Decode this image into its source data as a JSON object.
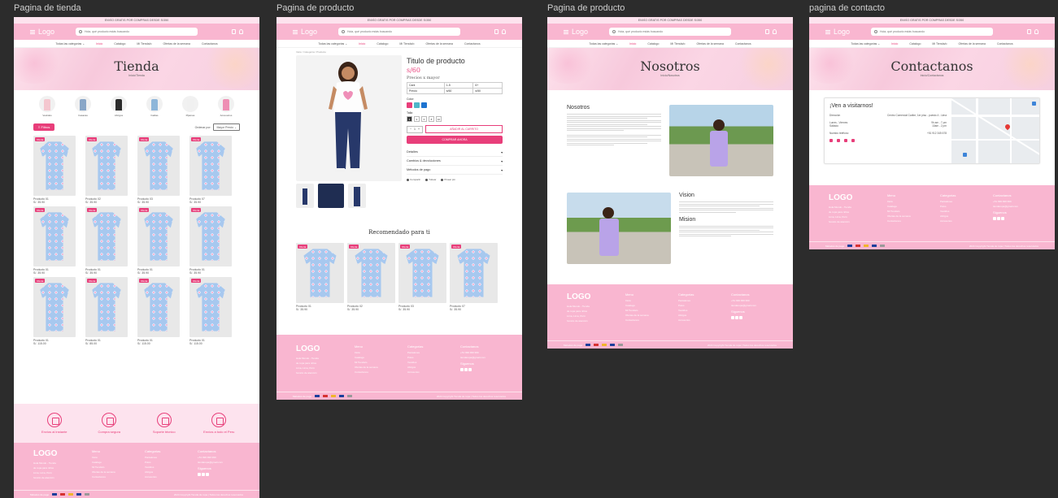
{
  "frame_labels": [
    "Pagina de tienda",
    "Pagina de producto",
    "Pagina de producto",
    "pagina de contacto"
  ],
  "common": {
    "promo": "ENVÍO GRATIS POR COMPRAS DESDE S/350",
    "logo": "Logo",
    "search_placeholder": "Hola, qué producto estás buscando",
    "nav": [
      "Todas las categorias",
      "Inicio",
      "Catalogo",
      "Mi Tienda/o",
      "Ofertas de la semana",
      "Contactanos"
    ],
    "footer": {
      "logo": "LOGO",
      "about": [
        "Hola Mundo - Tienda",
        "de ropa para niños",
        "Lima, Lima, Perú",
        "horario de atención"
      ],
      "col1_title": "Menu",
      "col1": [
        "Inicio",
        "Catalogo",
        "Mi Tienda/o",
        "Ofertas de la semana",
        "Contactanos"
      ],
      "col2_title": "Categorias",
      "col2": [
        "Pantalones",
        "Polos",
        "Vestidos",
        "Abrigos",
        "Accesorios"
      ],
      "col3_title": "Contactanos",
      "col3": [
        "+51 999 999 999",
        "tiendaropa@gmail.com"
      ],
      "follow": "Siguenos",
      "payment_label": "Métodos de pago",
      "copyright": "2024 Copyright Tienda de ropa | Todos los derechos reservados"
    }
  },
  "tienda": {
    "title": "Tienda",
    "breadcrumb": "Inicio/Tienda",
    "categories": [
      "Vestidos",
      "Casacas",
      "Abrigos",
      "Faldas",
      "Pijamas",
      "Accesorios"
    ],
    "filters_label": "Filtros",
    "sort_label": "Ordenar por:",
    "sort_value": "Mayor Precio",
    "badge": "Oferta",
    "products": [
      {
        "name": "Producto 01",
        "price": "S/. 35.90"
      },
      {
        "name": "Producto 02",
        "price": "S/. 35.90"
      },
      {
        "name": "Producto 03",
        "price": "S/. 35.90"
      },
      {
        "name": "Producto 07",
        "price": "S/. 35.90"
      },
      {
        "name": "Producto 01",
        "price": "S/. 35.90"
      },
      {
        "name": "Producto 01",
        "price": "S/. 35.90"
      },
      {
        "name": "Producto 01",
        "price": "S/. 35.90"
      },
      {
        "name": "Producto 01",
        "price": "S/. 35.90"
      },
      {
        "name": "Producto 01",
        "price": "S/. 115.00"
      },
      {
        "name": "Producto 01",
        "price": "S/. 85.00"
      },
      {
        "name": "Producto 01",
        "price": "S/. 115.00"
      },
      {
        "name": "Producto 01",
        "price": "S/. 115.00"
      }
    ],
    "services": [
      "Envíos al instante",
      "Compra segura",
      "Soporte técnico",
      "Envíos a todo el Peru"
    ]
  },
  "producto": {
    "breadcrumb": "Inicio / Categoria / Producto",
    "title": "Titulo de producto",
    "price": "s/60",
    "wholesale_title": "Precios x mayor",
    "table": {
      "head": [
        "Cant",
        "1-5",
        "6+"
      ],
      "row": [
        "Precio",
        "s/60",
        "s/50"
      ]
    },
    "color_label": "Color:",
    "colors": [
      "#e83e7a",
      "#4fb7c9",
      "#1e74d0"
    ],
    "size_label": "Talla",
    "sizes": [
      "2",
      "4",
      "6",
      "8",
      "10"
    ],
    "qty": "1",
    "add_cart": "AÑADIR AL CARRITO",
    "buy_now": "COMPRAR AHORA",
    "accordion": [
      "Detalles",
      "Cambios & devoluciones",
      "Métodos de pago"
    ],
    "share": [
      "Compartir",
      "Tuitear",
      "Pinear pin"
    ],
    "recommended_title": "Recomendado para ti",
    "recommended": [
      {
        "name": "Producto 01",
        "price": "S/. 35.90"
      },
      {
        "name": "Producto 02",
        "price": "S/. 35.90"
      },
      {
        "name": "Producto 03",
        "price": "S/. 35.90"
      },
      {
        "name": "Producto 07",
        "price": "S/. 35.90"
      }
    ]
  },
  "nosotros": {
    "title": "Nosotros",
    "breadcrumb": "Inicio/Nosotros",
    "s1_title": "Nosotros",
    "s2_title": "Vision",
    "s3_title": "Mision"
  },
  "contacto": {
    "title": "Contactanos",
    "breadcrumb": "Inicio/Contactanos",
    "card_title": "¡Ven a visitarnos!",
    "rows": [
      {
        "k": "Dirección",
        "v": "Centro Comercial Caribe, 1er piso - puesto 4 - Lima"
      },
      {
        "k": "Lunes - Viernes\nSabado",
        "v": "9h am - 7 pm\n10am - 2 pm"
      },
      {
        "k": "Nuestro teléfono",
        "v": "+51 912 345 678"
      }
    ]
  }
}
